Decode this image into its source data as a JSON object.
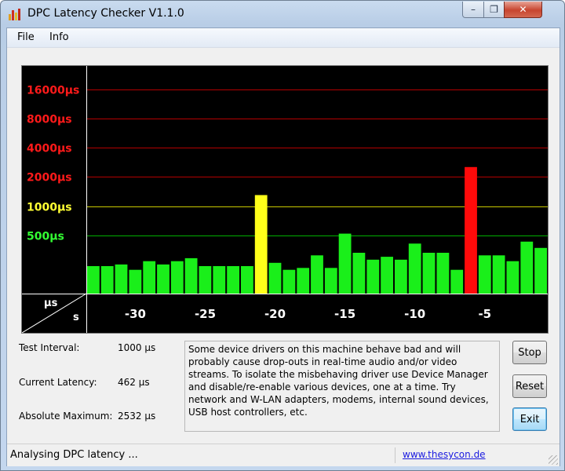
{
  "window": {
    "title": "DPC Latency Checker V1.1.0"
  },
  "menu": {
    "items": [
      "File",
      "Info"
    ]
  },
  "chart_data": {
    "type": "bar",
    "y_axis_labels": [
      {
        "label": "16000µs",
        "value": 16000,
        "color": "#ff1a1a"
      },
      {
        "label": "8000µs",
        "value": 8000,
        "color": "#ff1a1a"
      },
      {
        "label": "4000µs",
        "value": 4000,
        "color": "#ff1a1a"
      },
      {
        "label": "2000µs",
        "value": 2000,
        "color": "#ff1a1a"
      },
      {
        "label": "1000µs",
        "value": 1000,
        "color": "#ffff33"
      },
      {
        "label": "500µs",
        "value": 500,
        "color": "#33ff33"
      }
    ],
    "y_unit": "µs",
    "x_unit": "s",
    "x_ticks": [
      "-30",
      "-25",
      "-20",
      "-15",
      "-10",
      "-5"
    ],
    "x_tick_values": [
      -30,
      -25,
      -20,
      -15,
      -10,
      -5
    ],
    "x_start": -33,
    "x_end": -1,
    "y_scale": "log2",
    "y_min": 125,
    "y_max": 16000,
    "values": [
      240,
      240,
      250,
      220,
      270,
      250,
      270,
      290,
      240,
      240,
      240,
      240,
      1300,
      260,
      220,
      230,
      310,
      230,
      520,
      330,
      280,
      300,
      280,
      410,
      330,
      330,
      220,
      2532,
      310,
      310,
      270,
      430,
      370
    ],
    "colors": {
      "ok": "#1aef1a",
      "warn": "#ffff1a",
      "bad": "#ff0a0a"
    }
  },
  "stats": {
    "test_interval_label": "Test Interval:",
    "test_interval_value": "1000 µs",
    "current_latency_label": "Current Latency:",
    "current_latency_value": "462 µs",
    "absolute_max_label": "Absolute Maximum:",
    "absolute_max_value": "2532 µs"
  },
  "message": "Some device drivers on this machine behave bad and will probably cause drop-outs in real-time audio and/or video streams. To isolate the misbehaving driver use Device Manager and disable/re-enable various devices, one at a time. Try network and W-LAN adapters, modems, internal sound devices, USB host controllers, etc.",
  "buttons": {
    "stop": "Stop",
    "reset": "Reset",
    "exit": "Exit"
  },
  "status": {
    "text": "Analysing DPC latency ...",
    "link": "www.thesycon.de"
  }
}
